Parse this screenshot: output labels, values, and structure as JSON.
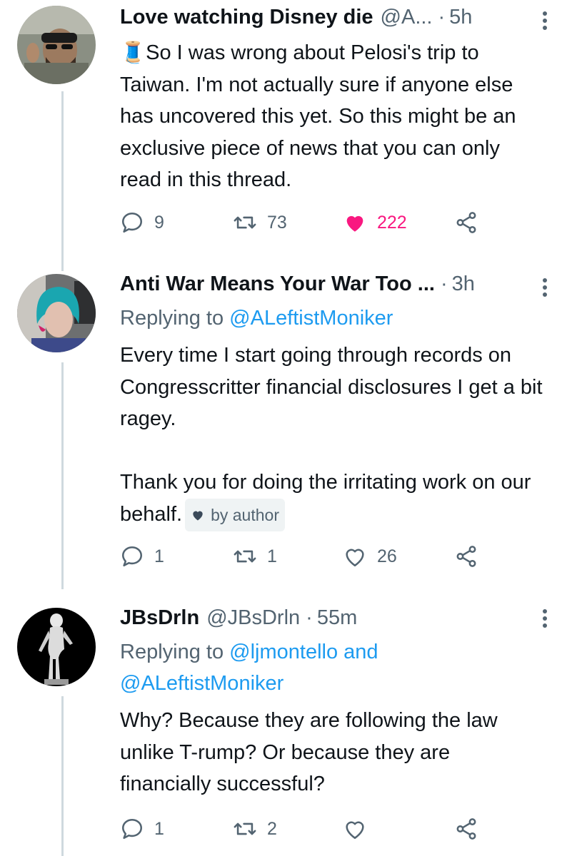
{
  "tweets": [
    {
      "name": "Love watching Disney die",
      "handle": "@A...",
      "time": "5h",
      "text": "🧵So I was wrong about Pelosi's trip to Taiwan.  I'm not actually sure if anyone else has uncovered this yet.  So this might be an exclusive piece of news that you can only read in this thread.",
      "replies": "9",
      "retweets": "73",
      "likes": "222"
    },
    {
      "name": "Anti War Means Your War Too ...",
      "time": "3h",
      "replying_prefix": "Replying to ",
      "replying_to": "@ALeftistMoniker",
      "text_p1": "Every time I start going through records on Congresscritter financial disclosures I get a bit ragey.",
      "text_p2": "Thank you for doing the irritating work on our behalf.",
      "badge": "by author",
      "replies": "1",
      "retweets": "1",
      "likes": "26"
    },
    {
      "name": "JBsDrln",
      "handle": "@JBsDrln",
      "time": "55m",
      "replying_prefix": "Replying to ",
      "replying_to_1": "@ljmontello",
      "replying_and": " and",
      "replying_to_2": "@ALeftistMoniker",
      "text": "Why?  Because they are following the law unlike T-rump? Or because they are financially successful?",
      "replies": "1",
      "retweets": "2"
    }
  ],
  "colors": {
    "accent": "#1d9bf0",
    "like": "#f91880",
    "muted": "#536471"
  },
  "icons": [
    "reply-icon",
    "retweet-icon",
    "like-icon",
    "share-icon",
    "more-icon",
    "heart-badge-icon"
  ]
}
